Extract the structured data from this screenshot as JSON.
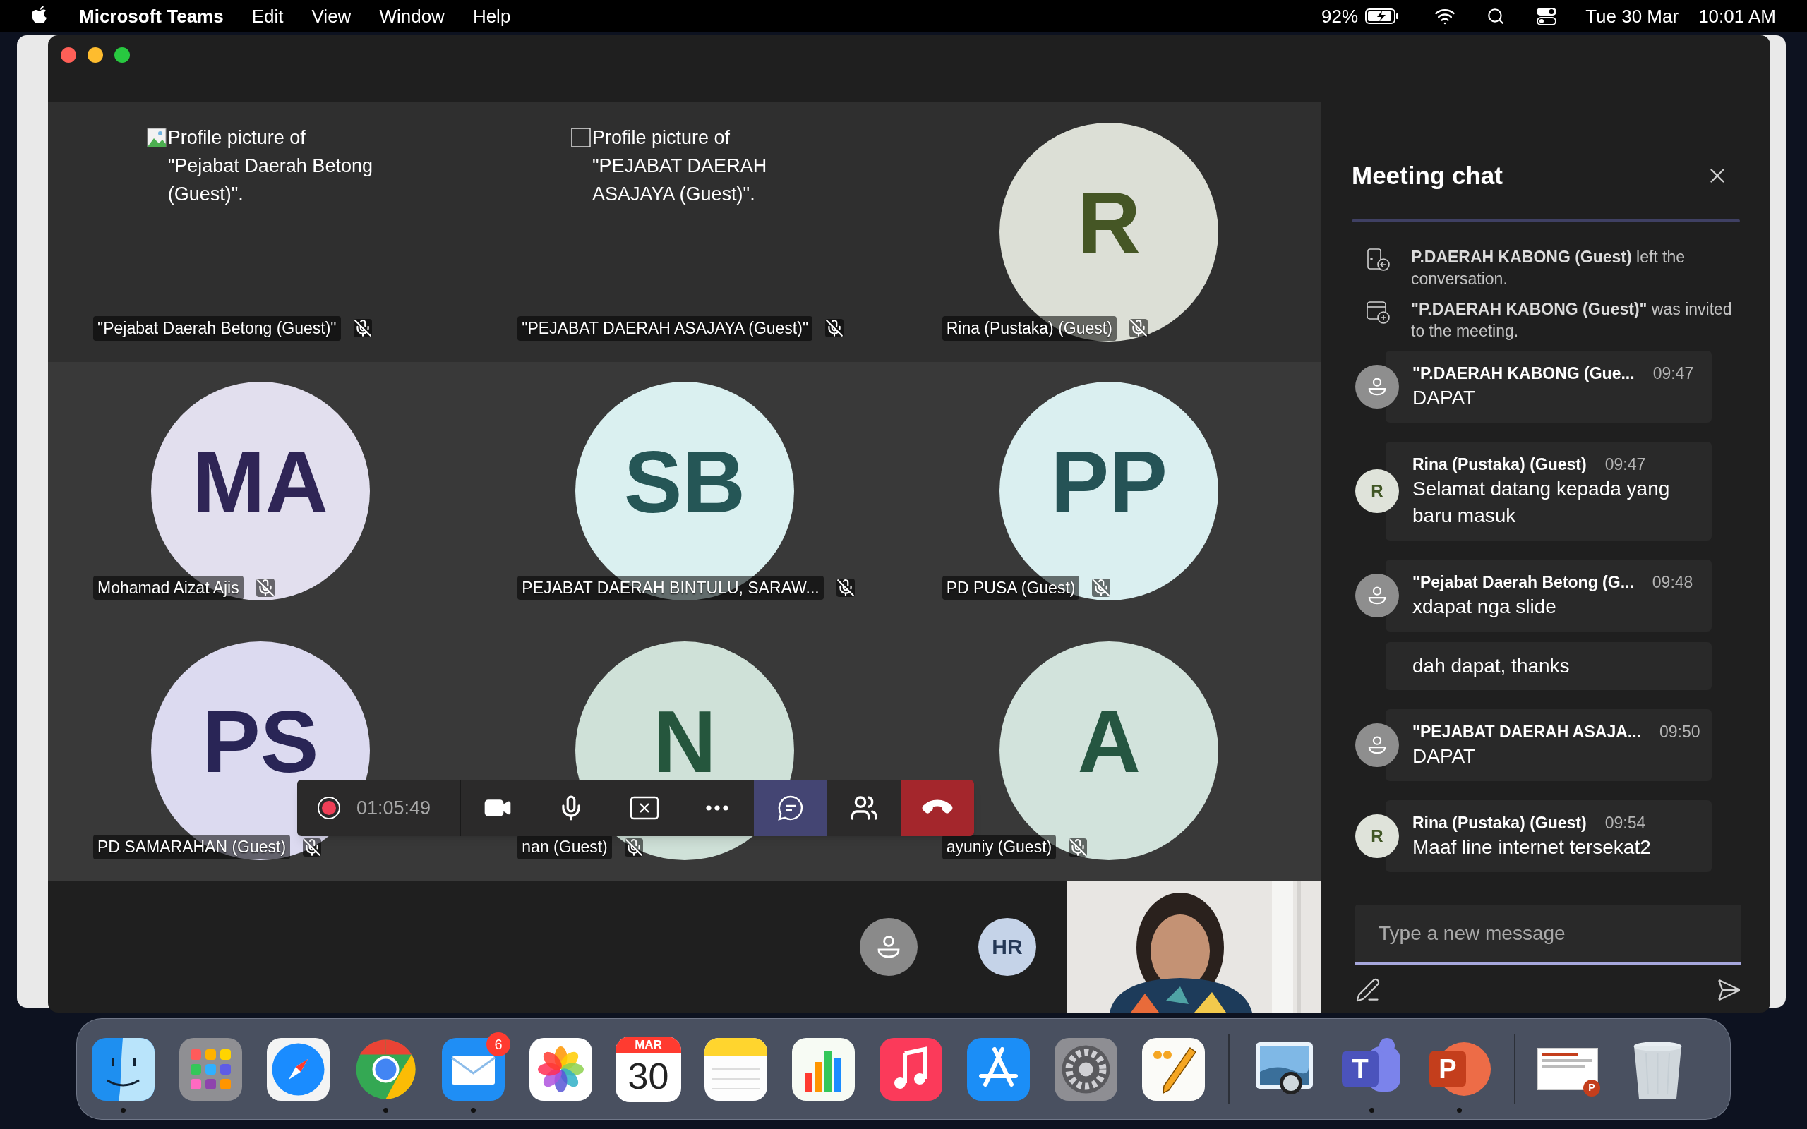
{
  "menu_bar": {
    "app": "Microsoft Teams",
    "menus": [
      "Edit",
      "View",
      "Window",
      "Help"
    ],
    "battery": "92%",
    "date": "Tue 30 Mar",
    "time": "10:01 AM"
  },
  "tiles": [
    {
      "kind": "broken_image",
      "alt": "Profile picture of \"Pejabat Daerah Betong (Guest)\".",
      "name": "\"Pejabat Daerah Betong (Guest)\"",
      "muted": true
    },
    {
      "kind": "empty_image",
      "alt": "Profile picture of \"PEJABAT DAERAH ASAJAYA (Guest)\".",
      "name": "\"PEJABAT DAERAH ASAJAYA (Guest)\"",
      "muted": true
    },
    {
      "kind": "initials",
      "initials": "R",
      "color": "#dcdfd6",
      "name": "Rina (Pustaka) (Guest)",
      "muted": true
    },
    {
      "kind": "initials",
      "initials": "MA",
      "color": "#e2dfee",
      "name": "Mohamad Aizat Ajis",
      "muted": true
    },
    {
      "kind": "initials",
      "initials": "SB",
      "color": "#daf0f0",
      "name": "PEJABAT DAERAH BINTULU, SARAW...",
      "muted": true
    },
    {
      "kind": "initials",
      "initials": "PP",
      "color": "#daeff0",
      "name": "PD PUSA (Guest)",
      "muted": true
    },
    {
      "kind": "initials",
      "initials": "PS",
      "color": "#dcdaf0",
      "name": "PD SAMARAHAN (Guest)",
      "muted": true
    },
    {
      "kind": "initials",
      "initials": "N",
      "color": "#cfe1d8",
      "name": "nan (Guest)",
      "muted": true
    },
    {
      "kind": "initials",
      "initials": "A",
      "color": "#d2e3dc",
      "name": "ayuniy (Guest)",
      "muted": true
    }
  ],
  "toolbar": {
    "recording": true,
    "timer": "01:05:49",
    "buttons": [
      {
        "kind": "camera",
        "selected": false
      },
      {
        "kind": "mic",
        "selected": false
      },
      {
        "kind": "share",
        "selected": false
      },
      {
        "kind": "more",
        "selected": false
      },
      {
        "kind": "chat",
        "selected": true
      },
      {
        "kind": "people",
        "selected": false
      },
      {
        "kind": "hangup",
        "selected": false
      }
    ]
  },
  "others": [
    {
      "kind": "generic"
    },
    {
      "kind": "initials",
      "initials": "HR",
      "color": "#c5d3e8"
    }
  ],
  "chat": {
    "title": "Meeting chat",
    "events": [
      {
        "kind": "left",
        "text": "**P.DAERAH KABONG (Guest)** left the conversation."
      },
      {
        "kind": "invited",
        "text": "**\"P.DAERAH KABONG (Guest)\"** was invited to the meeting."
      }
    ],
    "messages": [
      {
        "kind": "generic",
        "author": "\"P.DAERAH KABONG (Gue...",
        "time": "09:47",
        "text": "DAPAT"
      },
      {
        "kind": "initials",
        "initials": "R",
        "color": "#dfe3da",
        "author": "Rina (Pustaka) (Guest)",
        "time": "09:47",
        "text": "Selamat datang kepada yang baru masuk"
      },
      {
        "kind": "generic",
        "author": "\"Pejabat Daerah Betong (G...",
        "time": "09:48",
        "text": "xdapat nga slide"
      },
      {
        "kind": "continuation",
        "text": "dah dapat, thanks"
      },
      {
        "kind": "generic",
        "author": "\"PEJABAT DAERAH ASAJA...",
        "time": "09:50",
        "text": "DAPAT"
      },
      {
        "kind": "initials",
        "initials": "R",
        "color": "#dfe3da",
        "author": "Rina (Pustaka) (Guest)",
        "time": "09:54",
        "text": "Maaf line internet tersekat2"
      }
    ],
    "composer": {
      "placeholder": "Type a new message"
    }
  },
  "dock": {
    "apps": [
      {
        "kind": "finder",
        "running": true
      },
      {
        "kind": "launchpad",
        "running": false
      },
      {
        "kind": "safari",
        "running": false
      },
      {
        "kind": "chrome",
        "running": true
      },
      {
        "kind": "mail",
        "running": true,
        "badge": "6"
      },
      {
        "kind": "photos",
        "running": false
      },
      {
        "kind": "calendar",
        "running": false,
        "month": "MAR",
        "day": "30"
      },
      {
        "kind": "notes",
        "running": false
      },
      {
        "kind": "numbers",
        "running": false
      },
      {
        "kind": "music",
        "running": false
      },
      {
        "kind": "appstore",
        "running": false
      },
      {
        "kind": "settings",
        "running": false
      },
      {
        "kind": "quote",
        "running": false
      }
    ],
    "recent": [
      {
        "kind": "preview",
        "running": false
      },
      {
        "kind": "teams",
        "running": true,
        "letter": "T"
      },
      {
        "kind": "powerpoint",
        "running": true,
        "letter": "P"
      }
    ],
    "other": [
      {
        "kind": "document",
        "letter": "P"
      },
      {
        "kind": "trash"
      }
    ]
  }
}
